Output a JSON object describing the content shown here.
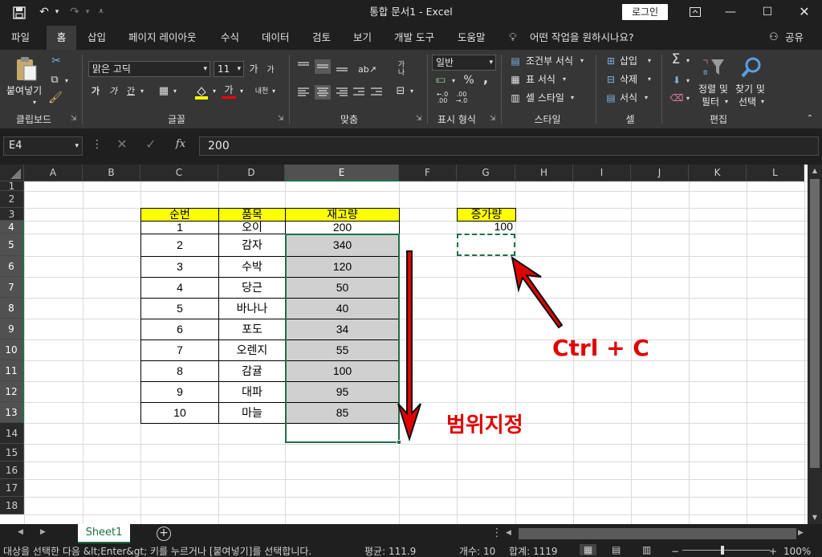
{
  "titlebar": {
    "title": "통합 문서1  -  Excel",
    "login": "로그인"
  },
  "tabs": [
    "파일",
    "홈",
    "삽입",
    "페이지 레이아웃",
    "수식",
    "데이터",
    "검토",
    "보기",
    "개발 도구",
    "도움말"
  ],
  "tell_me": "어떤 작업을 원하시나요?",
  "share": "공유",
  "ribbon": {
    "clipboard": {
      "paste": "붙여넣기",
      "label": "클립보드"
    },
    "font": {
      "name": "맑은 고딕",
      "size": "11",
      "label": "글꼴",
      "grow": "가",
      "shrink": "가",
      "bold": "가",
      "italic": "가",
      "underline": "간",
      "fontcolor": "가",
      "phonetic": "내천"
    },
    "align": {
      "label": "맞춤",
      "wrap": "가나"
    },
    "number": {
      "format": "일반",
      "label": "표시 형식",
      "percent": "%",
      "comma": ",",
      "inc": "←.0 .00",
      "dec": ".00 →.0"
    },
    "styles": {
      "cond": "조건부 서식",
      "table": "표 서식",
      "cell": "셀 스타일",
      "label": "스타일"
    },
    "cells": {
      "insert": "삽입",
      "delete": "삭제",
      "format": "서식",
      "label": "셀"
    },
    "editing": {
      "sort1": "정렬 및",
      "sort2": "필터",
      "find1": "찾기 및",
      "find2": "선택",
      "label": "편집"
    }
  },
  "formula": {
    "namebox": "E4",
    "fx": "fx",
    "value": "200"
  },
  "columns": [
    "A",
    "B",
    "C",
    "D",
    "E",
    "F",
    "G",
    "H",
    "I",
    "J",
    "K",
    "L"
  ],
  "rows": [
    "1",
    "2",
    "3",
    "4",
    "5",
    "6",
    "7",
    "8",
    "9",
    "10",
    "11",
    "12",
    "13",
    "14",
    "15",
    "16",
    "17",
    "18"
  ],
  "table": {
    "headers": [
      "순번",
      "품목",
      "재고량"
    ],
    "data": [
      [
        "1",
        "오이",
        "200"
      ],
      [
        "2",
        "감자",
        "340"
      ],
      [
        "3",
        "수박",
        "120"
      ],
      [
        "4",
        "당근",
        "50"
      ],
      [
        "5",
        "바나나",
        "40"
      ],
      [
        "6",
        "포도",
        "34"
      ],
      [
        "7",
        "오렌지",
        "55"
      ],
      [
        "8",
        "감귤",
        "100"
      ],
      [
        "9",
        "대파",
        "95"
      ],
      [
        "10",
        "마늘",
        "85"
      ]
    ]
  },
  "increase": {
    "header": "증가량",
    "value": "100"
  },
  "annotations": {
    "range": "범위지정",
    "copy": "Ctrl + C"
  },
  "sheet": {
    "name": "Sheet1",
    "add": "+"
  },
  "status": {
    "msg": "대상을 선택한 다음 &lt;Enter&gt; 키를 누르거나 [붙여넣기]를 선택합니다.",
    "avg": "평균: 111.9",
    "count": "개수: 10",
    "sum": "합계: 1119",
    "zoom": "100%"
  },
  "colors": {
    "accent": "#1e7145",
    "annotation": "#e00000",
    "header_fill": "#ffff00",
    "selection_fill": "#d0d0d0"
  }
}
